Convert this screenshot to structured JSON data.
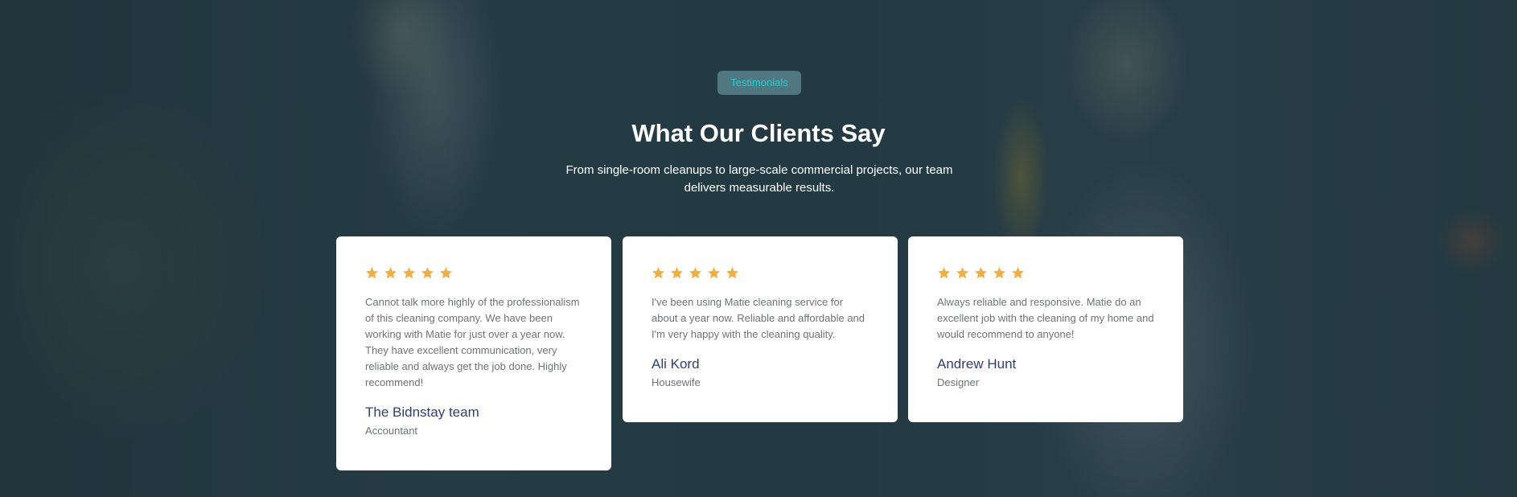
{
  "section": {
    "badge": "Testimonials",
    "title": "What Our Clients Say",
    "subtitle": "From single-room cleanups to large-scale commercial projects, our team delivers measurable results."
  },
  "colors": {
    "star": "#f6ad3a",
    "badge_text": "#2fc9cf",
    "name": "#2e3e77"
  },
  "testimonials": [
    {
      "rating": 5,
      "quote": "Cannot talk more highly of the professionalism of this cleaning company. We have been working with Matie for just over a year now. They have excellent communication, very reliable and always get the job done. Highly recommend!",
      "name": "The Bidnstay team",
      "role": "Accountant"
    },
    {
      "rating": 5,
      "quote": "I've been using Matie cleaning service for about a year now. Reliable and affordable and I'm very happy with the cleaning quality.",
      "name": "Ali Kord",
      "role": "Housewife"
    },
    {
      "rating": 5,
      "quote": "Always reliable and responsive. Matie do an excellent job with the cleaning of my home and would recommend to anyone!",
      "name": "Andrew Hunt",
      "role": "Designer"
    }
  ]
}
